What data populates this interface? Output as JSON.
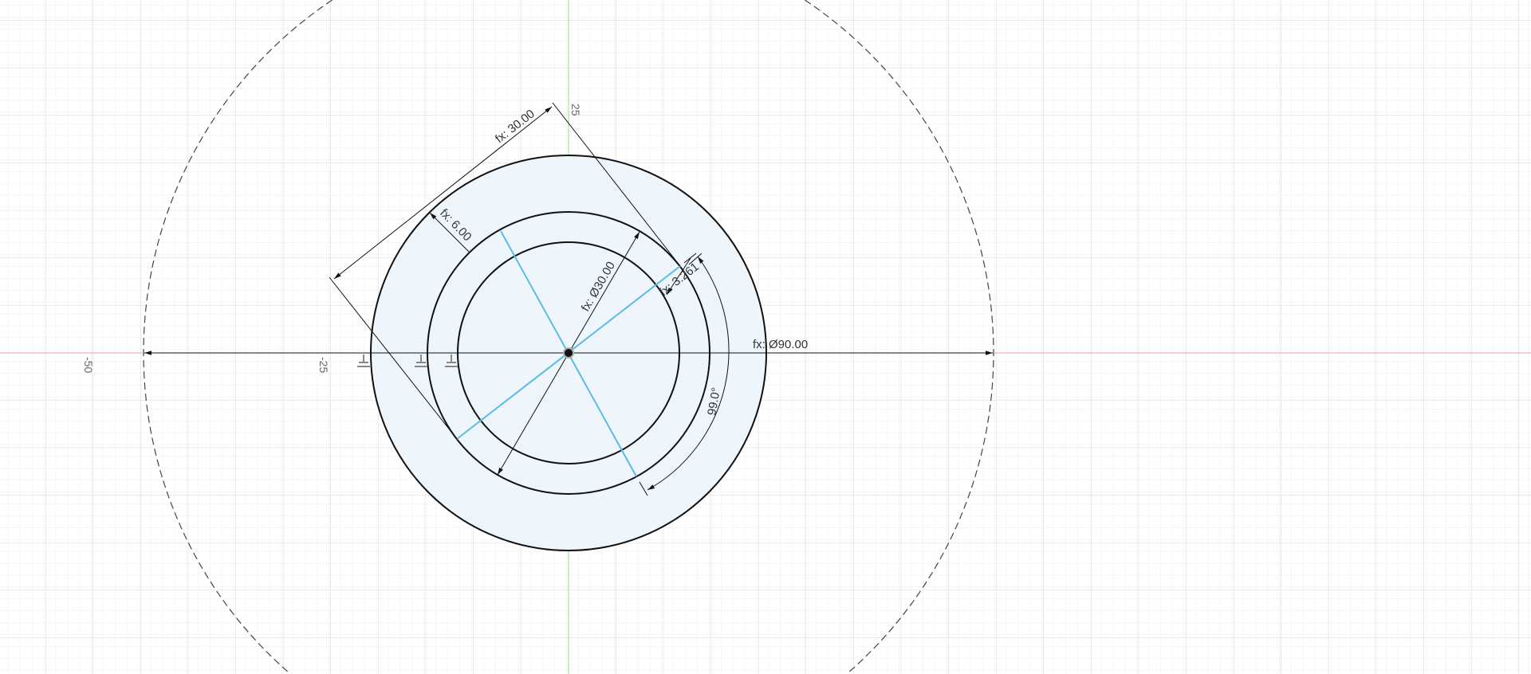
{
  "canvas": {
    "axis_labels": {
      "y_25": "25",
      "x_neg25": "-25",
      "x_neg50": "-50"
    },
    "dimensions": {
      "outer_diameter": "fx: Ø90.00",
      "inner_diameter": "fx: Ø30.00",
      "length": "fx: 30.00",
      "offset": "fx: 6.00",
      "small_offset": "fx: 3.261",
      "angle": "99.0°"
    },
    "colors": {
      "x_axis": "#f4a0a0",
      "y_axis": "#8fe08f",
      "profile_fill": "#eef6fb",
      "construction_line": "#5bbbe8",
      "sketch_line": "#111111"
    }
  }
}
